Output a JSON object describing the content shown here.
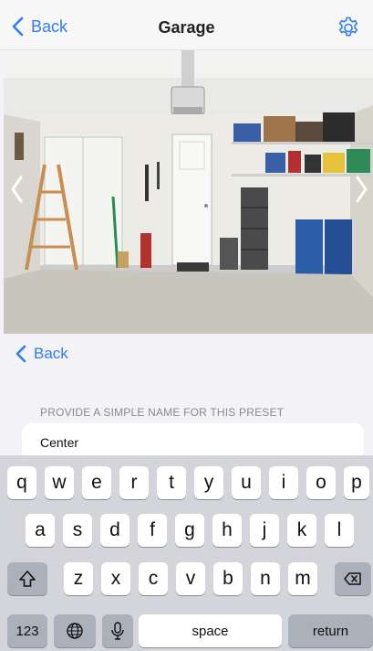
{
  "navbar": {
    "back_label": "Back",
    "title": "Garage"
  },
  "sheet": {
    "back_label": "Back",
    "section_header": "PROVIDE A SIMPLE NAME FOR THIS PRESET",
    "preset_name_value": "Center"
  },
  "keyboard": {
    "row1": [
      "q",
      "w",
      "e",
      "r",
      "t",
      "y",
      "u",
      "i",
      "o",
      "p"
    ],
    "row2": [
      "a",
      "s",
      "d",
      "f",
      "g",
      "h",
      "j",
      "k",
      "l"
    ],
    "row3": [
      "z",
      "x",
      "c",
      "v",
      "b",
      "n",
      "m"
    ],
    "numbers_label": "123",
    "space_label": "space",
    "return_label": "return"
  },
  "icons": {
    "back": "chevron-left-icon",
    "settings": "gear-icon",
    "prev": "chevron-left-icon",
    "next": "chevron-right-icon",
    "shift": "shift-icon",
    "delete": "delete-icon",
    "globe": "globe-icon",
    "mic": "microphone-icon"
  },
  "colors": {
    "accent": "#2f7cf6",
    "keyboard_bg": "#d3d5db"
  }
}
